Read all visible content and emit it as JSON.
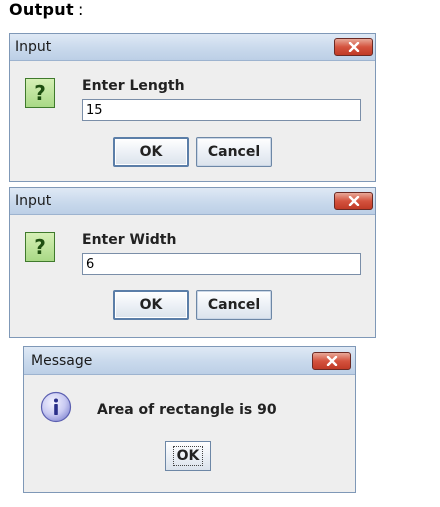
{
  "heading": {
    "text": "Output",
    "colon": ":"
  },
  "dialogs": [
    {
      "title": "Input",
      "prompt": "Enter Length",
      "input_value": "15",
      "ok_label": "OK",
      "cancel_label": "Cancel",
      "icon": "question-icon"
    },
    {
      "title": "Input",
      "prompt": "Enter Width",
      "input_value": "6",
      "ok_label": "OK",
      "cancel_label": "Cancel",
      "icon": "question-icon"
    }
  ],
  "message_dialog": {
    "title": "Message",
    "text": "Area of rectangle is 90",
    "ok_label": "OK",
    "icon": "info-icon"
  },
  "colors": {
    "titlebar": "#c9d9ec",
    "close_button": "#d4533e",
    "question_icon": "#a9d986",
    "info_icon": "#8b8fd6",
    "dialog_bg": "#eeeeee"
  }
}
